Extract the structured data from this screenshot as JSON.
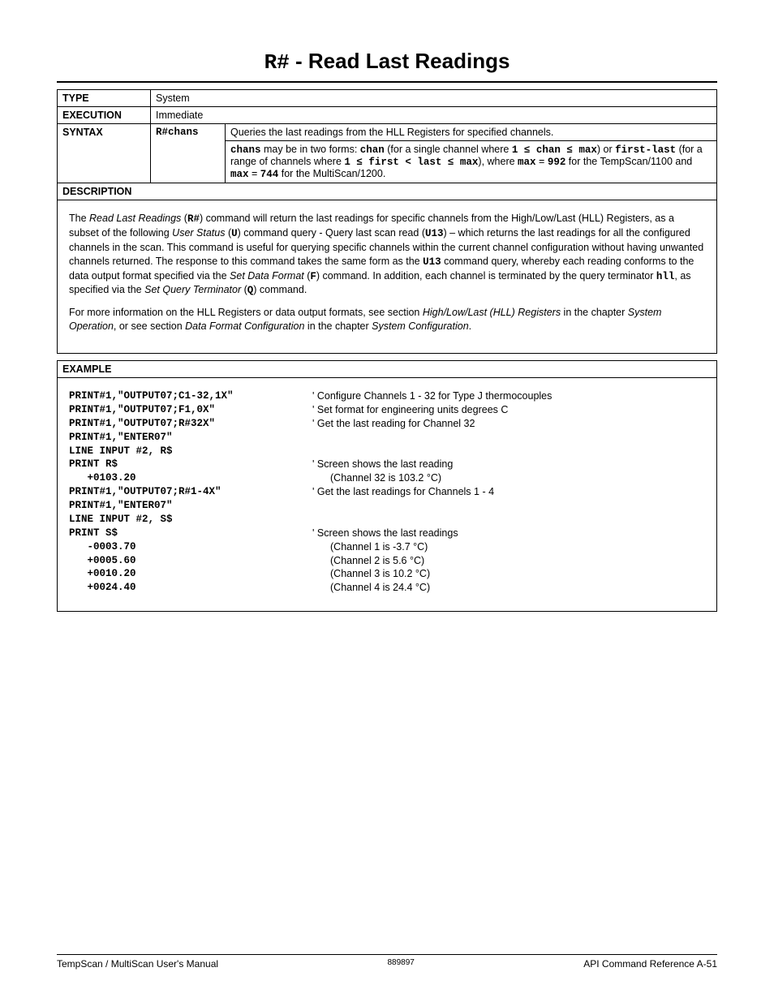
{
  "title_code": "R#",
  "title_sep": " - ",
  "title_text": "Read Last Readings",
  "rows": {
    "type_label": "TYPE",
    "type_value": "System",
    "exec_label": "EXECUTION",
    "exec_value": "Immediate",
    "syntax_label": "SYNTAX",
    "syntax_code": "R#chans",
    "syntax_desc1": "Queries the last readings from the HLL Registers for specified channels.",
    "syntax_desc2a": "chans",
    "syntax_desc2b": " may be in two forms: ",
    "syntax_desc2c": "chan",
    "syntax_desc2d": " (for a single channel where ",
    "syntax_desc2e": "1 ≤ chan ≤ max",
    "syntax_desc2f": ") or ",
    "syntax_desc2g": "first-last",
    "syntax_desc2h": " (for a range of channels where ",
    "syntax_desc2i": "1 ≤ first < last ≤ max",
    "syntax_desc2j": "), where ",
    "syntax_desc2k": "max",
    "syntax_desc2l": " = ",
    "syntax_desc2m": "992",
    "syntax_desc2n": " for the TempScan/1100 and ",
    "syntax_desc2o": "max",
    "syntax_desc2p": " = ",
    "syntax_desc2q": "744",
    "syntax_desc2r": " for the MultiScan/1200.",
    "desc_label": "DESCRIPTION"
  },
  "desc": {
    "p1a": "The ",
    "p1b": "Read Last Readings",
    "p1c": " (",
    "p1d": "R#",
    "p1e": ") command will return the last readings for specific channels from the High/Low/Last (HLL) Registers, as a subset of the following ",
    "p1f": "User Status",
    "p1g": " (",
    "p1h": "U",
    "p1i": ") command query - Query last scan read (",
    "p1j": "U13",
    "p1k": ") – which returns the last readings for all the configured channels in the scan.  This command is useful for querying specific channels within the current channel configuration without having unwanted channels returned.  The response to this command takes the same form as the ",
    "p1l": "U13",
    "p1m": " command query, whereby each reading conforms to the data output format specified via the ",
    "p1n": "Set Data Format",
    "p1o": " (",
    "p1p": "F",
    "p1q": ") command.  In addition, each channel is terminated by the query terminator ",
    "p1r": "hll",
    "p1s": ", as specified via the ",
    "p1t": "Set Query Terminator",
    "p1u": " (",
    "p1v": "Q",
    "p1w": ") command.",
    "p2a": "For more information on the HLL Registers or data output formats, see section ",
    "p2b": "High/Low/Last (HLL) Registers",
    "p2c": " in the chapter ",
    "p2d": "System Operation",
    "p2e": ", or see section ",
    "p2f": "Data Format Configuration",
    "p2g": " in the chapter ",
    "p2h": "System Configuration",
    "p2i": "."
  },
  "example_label": "EXAMPLE",
  "ex": [
    {
      "l": "PRINT#1,\"OUTPUT07;C1-32,1X\"",
      "r": "' Configure Channels 1 - 32 for Type J thermocouples"
    },
    {
      "l": "PRINT#1,\"OUTPUT07;F1,0X\"",
      "r": "' Set format for engineering units degrees C"
    },
    {
      "l": "PRINT#1,\"OUTPUT07;R#32X\"",
      "r": "' Get the last reading for Channel 32"
    },
    {
      "l": "PRINT#1,\"ENTER07\"",
      "r": ""
    },
    {
      "l": "LINE INPUT #2, R$",
      "r": ""
    },
    {
      "l": "PRINT R$",
      "r": "' Screen shows the last reading"
    },
    {
      "l": "   +0103.20",
      "r": "   (Channel 32 is 103.2 °C)",
      "indent": true
    },
    {
      "l": "PRINT#1,\"OUTPUT07;R#1-4X\"",
      "r": "' Get the last readings for Channels 1 - 4"
    },
    {
      "l": "PRINT#1,\"ENTER07\"",
      "r": ""
    },
    {
      "l": "LINE INPUT #2, S$",
      "r": ""
    },
    {
      "l": "PRINT S$",
      "r": "' Screen shows the last readings"
    },
    {
      "l": "   -0003.70",
      "r": "   (Channel 1 is -3.7 °C)",
      "indent": true
    },
    {
      "l": "   +0005.60",
      "r": "   (Channel 2 is 5.6 °C)",
      "indent": true
    },
    {
      "l": "   +0010.20",
      "r": "   (Channel 3 is 10.2 °C)",
      "indent": true
    },
    {
      "l": "   +0024.40",
      "r": "   (Channel 4 is 24.4 °C)",
      "indent": true
    }
  ],
  "footer": {
    "left": "TempScan / MultiScan User's Manual",
    "mid": "889897",
    "right_a": "API Command Reference   ",
    "right_b": "A-51"
  }
}
